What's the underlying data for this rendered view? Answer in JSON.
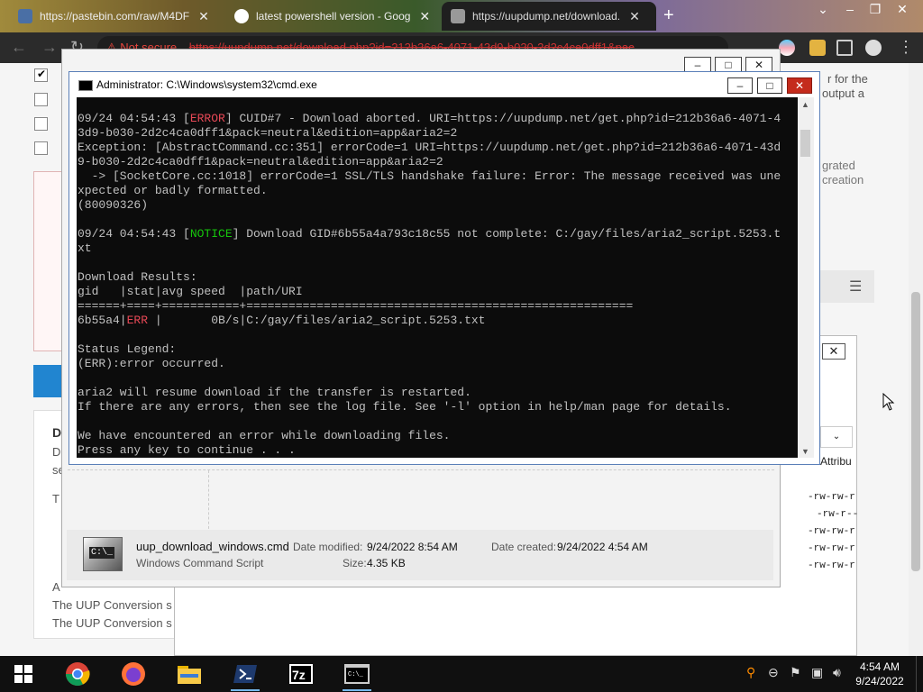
{
  "browser": {
    "tabs": [
      {
        "label": "https://pastebin.com/raw/M4DF",
        "favicon_color": "#4a6fa5"
      },
      {
        "label": "latest powershell version - Goog",
        "favicon_color": "#ffffff"
      },
      {
        "label": "https://uupdump.net/download.",
        "favicon_color": "#999999",
        "active": true
      }
    ],
    "security_label": "Not secure",
    "url": "https://uupdump.net/download.php?id=212b36a6-4071-43d9-b030-2d2c4ca0dff1&pac"
  },
  "page": {
    "right_text": [
      "r for the",
      "output a",
      "grated",
      "creation"
    ],
    "left_text": [
      "D",
      "D",
      "se",
      "T",
      "A",
      "The UUP Conversion s",
      "The UUP Conversion s"
    ]
  },
  "explorer": {
    "column_attrib": "Attribu",
    "perms": [
      "-rw-rw-r",
      "-rw-r--",
      "-rw-rw-r",
      "-rw-rw-r",
      "-rw-rw-r"
    ],
    "file": {
      "name": "uup_download_windows.cmd",
      "type": "Windows Command Script",
      "modified_label": "Date modified:",
      "modified": "9/24/2022 8:54 AM",
      "created_label": "Date created:",
      "created": "9/24/2022 4:54 AM",
      "size_label": "Size:",
      "size": "4.35 KB"
    }
  },
  "cmd": {
    "title": "Administrator: C:\\Windows\\system32\\cmd.exe",
    "lines": [
      [
        {
          "t": "09/24 04:54:43 ["
        },
        {
          "t": "ERROR",
          "c": "red"
        },
        {
          "t": "] CUID#7 - Download aborted. URI=https://uupdump.net/get.php?id=212b36a6-4071-4"
        }
      ],
      [
        {
          "t": "3d9-b030-2d2c4ca0dff1&pack=neutral&edition=app&aria2=2"
        }
      ],
      [
        {
          "t": "Exception: [AbstractCommand.cc:351] errorCode=1 URI=https://uupdump.net/get.php?id=212b36a6-4071-43d"
        }
      ],
      [
        {
          "t": "9-b030-2d2c4ca0dff1&pack=neutral&edition=app&aria2=2"
        }
      ],
      [
        {
          "t": "  -> [SocketCore.cc:1018] errorCode=1 SSL/TLS handshake failure: Error: The message received was une"
        }
      ],
      [
        {
          "t": "xpected or badly formatted."
        }
      ],
      [
        {
          "t": "(80090326)"
        }
      ],
      [
        {
          "t": ""
        }
      ],
      [
        {
          "t": "09/24 04:54:43 ["
        },
        {
          "t": "NOTICE",
          "c": "green"
        },
        {
          "t": "] Download GID#6b55a4a793c18c55 not complete: C:/gay/files/aria2_script.5253.t"
        }
      ],
      [
        {
          "t": "xt"
        }
      ],
      [
        {
          "t": ""
        }
      ],
      [
        {
          "t": "Download Results:"
        }
      ],
      [
        {
          "t": "gid   |stat|avg speed  |path/URI"
        }
      ],
      [
        {
          "t": "======+====+===========+======================================================="
        }
      ],
      [
        {
          "t": "6b55a4|"
        },
        {
          "t": "ERR",
          "c": "red"
        },
        {
          "t": " |       0B/s|C:/gay/files/aria2_script.5253.txt"
        }
      ],
      [
        {
          "t": ""
        }
      ],
      [
        {
          "t": "Status Legend:"
        }
      ],
      [
        {
          "t": "(ERR):error occurred."
        }
      ],
      [
        {
          "t": ""
        }
      ],
      [
        {
          "t": "aria2 will resume download if the transfer is restarted."
        }
      ],
      [
        {
          "t": "If there are any errors, then see the log file. See '-l' option in help/man page for details."
        }
      ],
      [
        {
          "t": ""
        }
      ],
      [
        {
          "t": "We have encountered an error while downloading files."
        }
      ],
      [
        {
          "t": "Press any key to continue . . ."
        }
      ]
    ]
  },
  "taskbar": {
    "apps": [
      "windows-start",
      "chrome",
      "firefox",
      "file-explorer",
      "powershell",
      "7zip",
      "cmd"
    ],
    "time": "4:54 AM",
    "date": "9/24/2022"
  }
}
